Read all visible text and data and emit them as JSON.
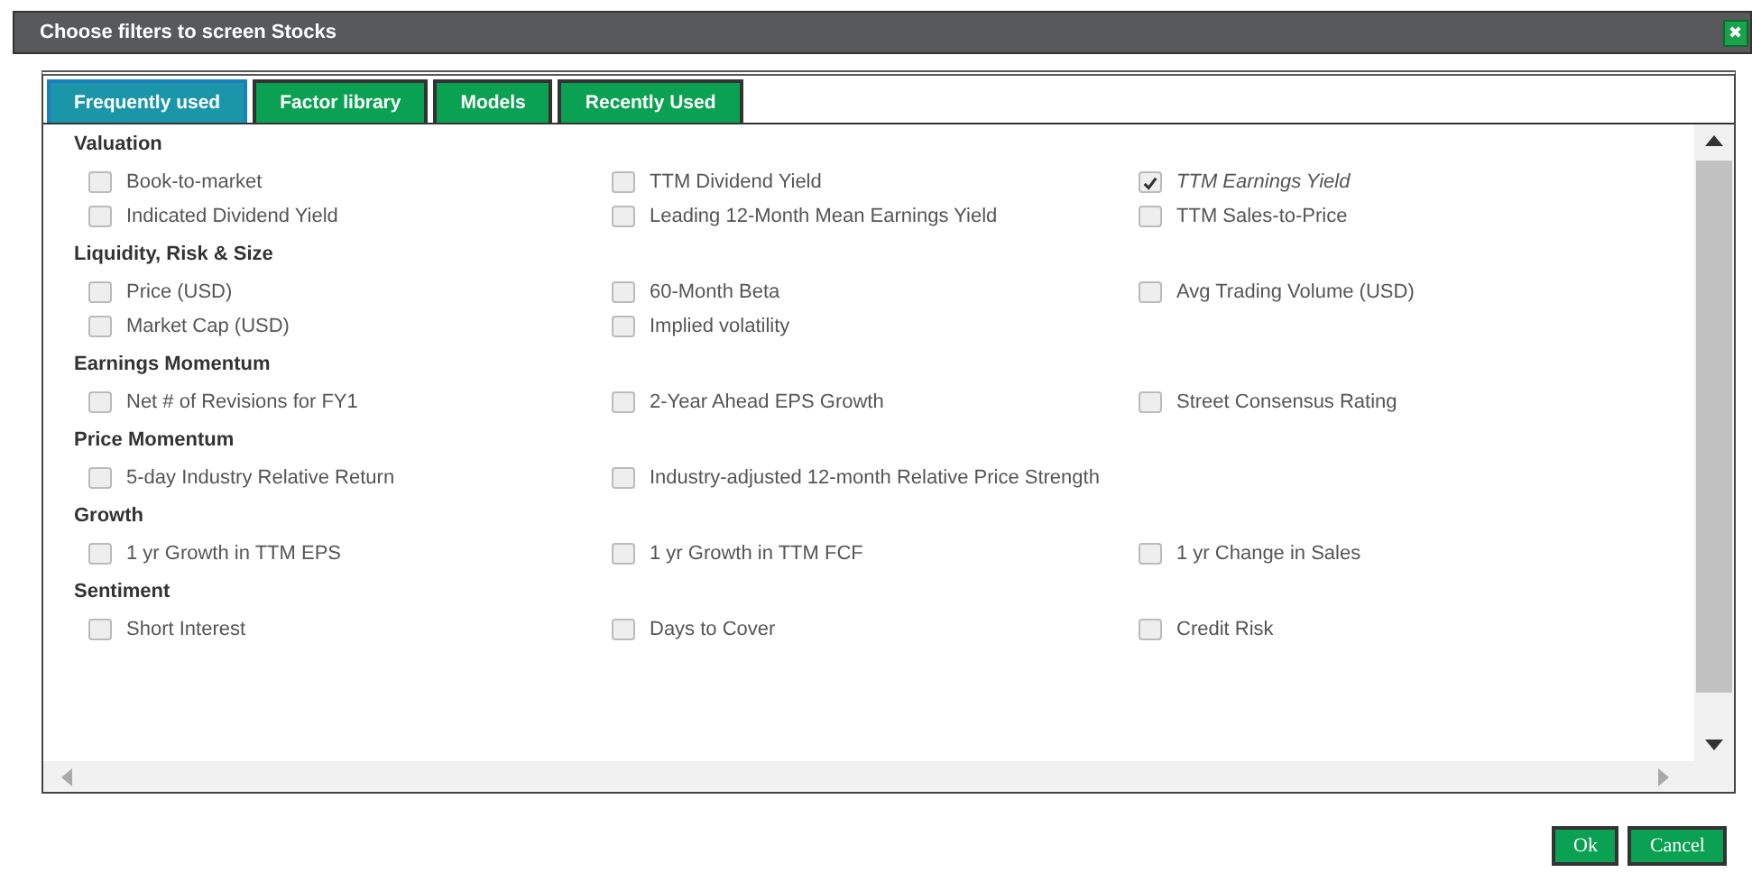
{
  "window": {
    "title": "Choose filters to screen Stocks",
    "close": "✖"
  },
  "tabs": [
    {
      "label": "Frequently used",
      "selected": true
    },
    {
      "label": "Factor library",
      "selected": false
    },
    {
      "label": "Models",
      "selected": false
    },
    {
      "label": "Recently Used",
      "selected": false
    }
  ],
  "sections": [
    {
      "title": "Valuation",
      "items": [
        {
          "label": "Book-to-market",
          "checked": false
        },
        {
          "label": "TTM Dividend Yield",
          "checked": false
        },
        {
          "label": "TTM Earnings Yield",
          "checked": true
        },
        {
          "label": "Indicated Dividend Yield",
          "checked": false
        },
        {
          "label": "Leading 12-Month Mean Earnings Yield",
          "checked": false
        },
        {
          "label": "TTM Sales-to-Price",
          "checked": false
        }
      ]
    },
    {
      "title": "Liquidity, Risk & Size",
      "items": [
        {
          "label": "Price (USD)",
          "checked": false
        },
        {
          "label": "60-Month Beta",
          "checked": false
        },
        {
          "label": "Avg Trading Volume (USD)",
          "checked": false
        },
        {
          "label": "Market Cap (USD)",
          "checked": false
        },
        {
          "label": "Implied volatility",
          "checked": false
        }
      ]
    },
    {
      "title": "Earnings Momentum",
      "items": [
        {
          "label": "Net # of Revisions for FY1",
          "checked": false
        },
        {
          "label": "2-Year Ahead EPS Growth",
          "checked": false
        },
        {
          "label": "Street Consensus Rating",
          "checked": false
        }
      ]
    },
    {
      "title": "Price Momentum",
      "items": [
        {
          "label": "5-day Industry Relative Return",
          "checked": false
        },
        {
          "label": "Industry-adjusted 12-month Relative Price Strength",
          "checked": false
        }
      ]
    },
    {
      "title": "Growth",
      "items": [
        {
          "label": "1 yr Growth in TTM EPS",
          "checked": false
        },
        {
          "label": "1 yr Growth in TTM FCF",
          "checked": false
        },
        {
          "label": "1 yr Change in Sales",
          "checked": false
        }
      ]
    },
    {
      "title": "Sentiment",
      "items": [
        {
          "label": "Short Interest",
          "checked": false
        },
        {
          "label": "Days to Cover",
          "checked": false
        },
        {
          "label": "Credit Risk",
          "checked": false
        }
      ]
    }
  ],
  "buttons": [
    "Ok",
    "Cancel"
  ]
}
